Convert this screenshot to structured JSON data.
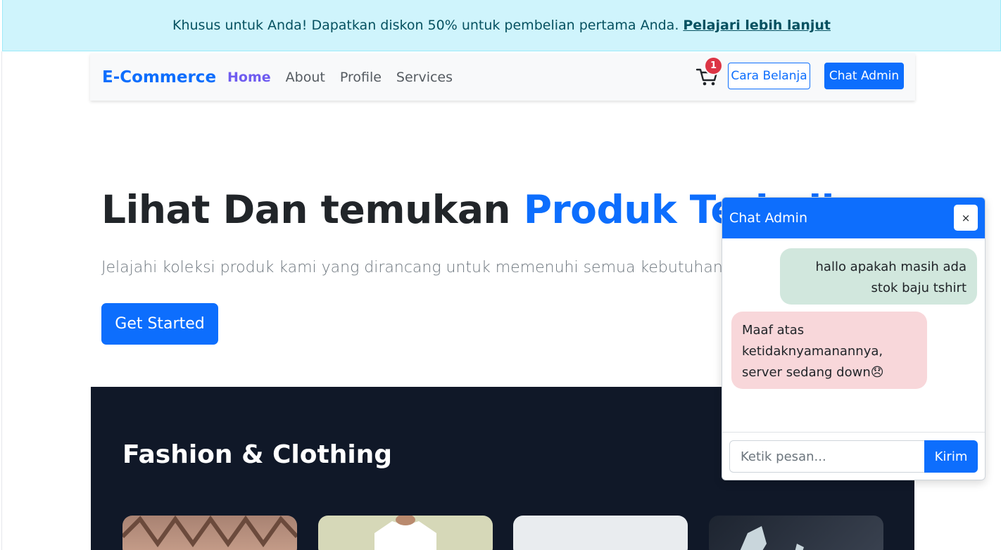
{
  "promo": {
    "text": "Khusus untuk Anda! Dapatkan diskon 50% untuk pembelian pertama Anda.",
    "link": "Pelajari lebih lanjut"
  },
  "navbar": {
    "brand": "E-Commerce",
    "links": [
      "Home",
      "About",
      "Profile",
      "Services"
    ],
    "active_link": "Home",
    "cart_count": "1",
    "cara_belanja": "Cara Belanja",
    "chat_admin": "Chat Admin"
  },
  "hero": {
    "title_plain": "Lihat Dan temukan ",
    "title_accent": "Produk Terbaik",
    "subtitle": "Jelajahi koleksi produk kami yang dirancang untuk memenuhi semua kebutuhan Anda.",
    "cta": "Get Started"
  },
  "fashion": {
    "title": "Fashion & Clothing"
  },
  "chat": {
    "title": "Chat Admin",
    "close": "×",
    "messages": [
      {
        "from": "user",
        "text": "hallo apakah masih ada stok baju tshirt"
      },
      {
        "from": "admin",
        "text": "Maaf atas ketidaknyamanannya, server sedang down😞"
      }
    ],
    "input_placeholder": "Ketik pesan...",
    "send_label": "Kirim"
  },
  "colors": {
    "primary": "#0d6efd",
    "promo_bg": "#cff4fc",
    "dark_section": "#101828",
    "user_bubble": "#d1e7dd",
    "admin_bubble": "#f8d7da",
    "badge": "#dc3545"
  },
  "icons": {
    "cart": "cart-icon"
  }
}
